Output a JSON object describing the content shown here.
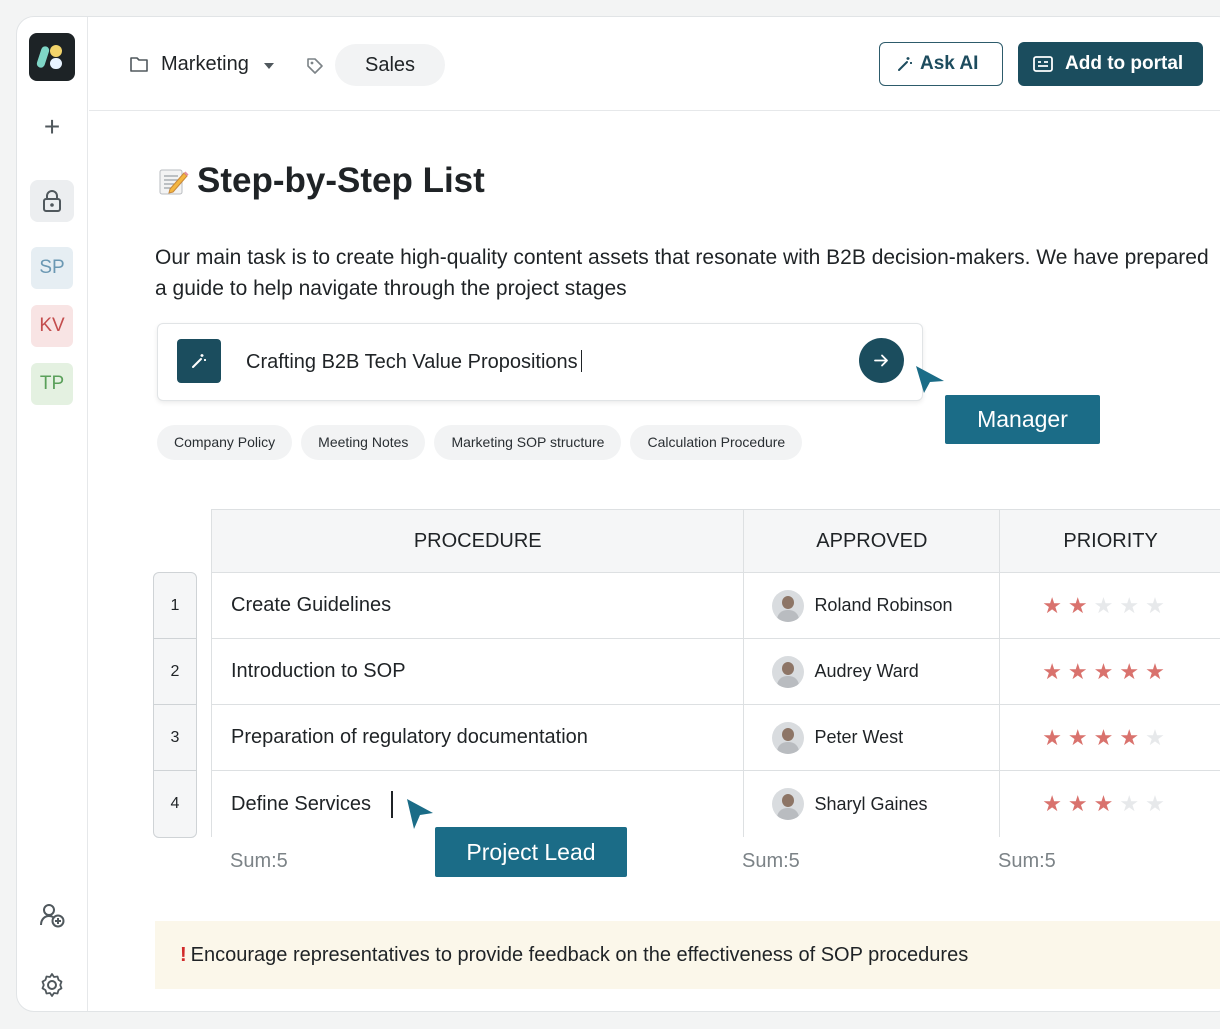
{
  "sidebar": {
    "avatars": [
      {
        "initials": "SP",
        "bg": "#e6eef3",
        "fg": "#6b98b3"
      },
      {
        "initials": "KV",
        "bg": "#f8e4e4",
        "fg": "#c34d4d"
      },
      {
        "initials": "TP",
        "bg": "#e4f1e1",
        "fg": "#5aa05a"
      }
    ]
  },
  "topbar": {
    "breadcrumb": "Marketing",
    "tag": "Sales",
    "ask_ai_label": "Ask AI",
    "add_portal_label": "Add to portal"
  },
  "page": {
    "title": "Step-by-Step List",
    "intro": "Our main task is to create high-quality content assets that resonate with B2B decision-makers. We have prepared a guide to help navigate through the project stages"
  },
  "prompt": {
    "value": "Crafting B2B Tech Value Propositions"
  },
  "suggestions": [
    "Company Policy",
    "Meeting Notes",
    "Marketing SOP structure",
    "Calculation Procedure"
  ],
  "cursors": {
    "manager": "Manager",
    "project_lead": "Project Lead"
  },
  "table": {
    "headers": [
      "PROCEDURE",
      "APPROVED",
      "PRIORITY"
    ],
    "rows": [
      {
        "num": "1",
        "procedure": "Create Guidelines",
        "approved": "Roland Robinson",
        "priority": 2
      },
      {
        "num": "2",
        "procedure": "Introduction to SOP",
        "approved": "Audrey Ward",
        "priority": 5
      },
      {
        "num": "3",
        "procedure": "Preparation of regulatory documentation",
        "approved": "Peter West",
        "priority": 4
      },
      {
        "num": "4",
        "procedure": "Define Services",
        "approved": "Sharyl Gaines",
        "priority": 3
      }
    ],
    "sums": [
      "Sum:5",
      "Sum:5",
      "Sum:5"
    ],
    "star_max": 5,
    "star_on_color": "#d9726d",
    "star_off_color": "#e7e9eb"
  },
  "callout": {
    "text": "Encourage representatives to provide feedback on the effectiveness of SOP procedures"
  },
  "colors": {
    "accent": "#1b4d5e",
    "cursor_label": "#1b6c87"
  }
}
